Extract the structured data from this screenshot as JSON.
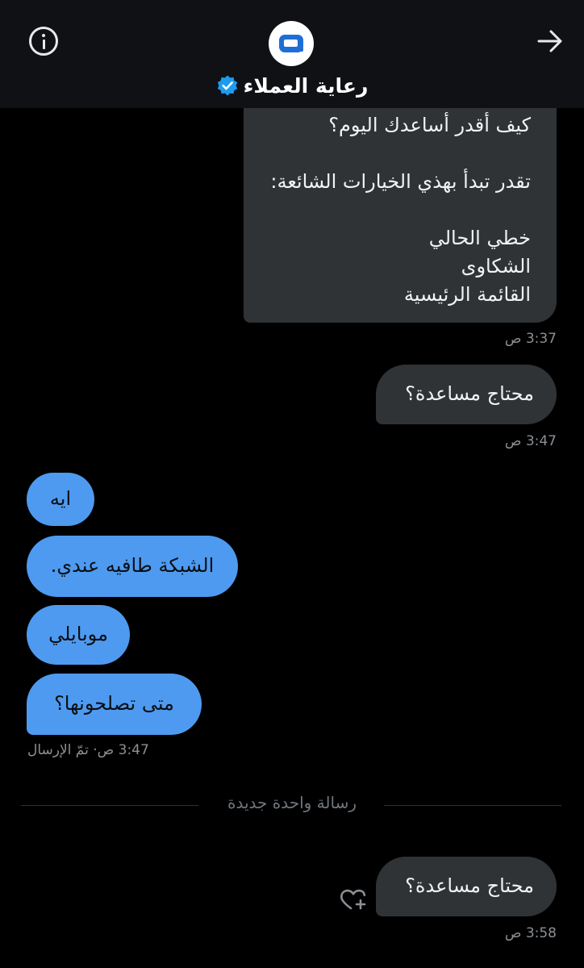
{
  "header": {
    "title": "رعاية العملاء",
    "avatar_icon": "mobily-logo-icon",
    "info_icon": "info-icon",
    "forward_icon": "arrow-right-icon",
    "verified_icon": "verified-badge-icon"
  },
  "colors": {
    "background": "#000000",
    "header": "#0f1114",
    "received_bubble": "#2f3336",
    "sent_bubble": "#4e9af0",
    "accent": "#1d9bf0",
    "timestamp": "#8b8f94"
  },
  "messages": {
    "menu": {
      "line1": "كيف أقدر أساعدك اليوم؟",
      "line2": "تقدر تبدأ بهذي الخيارات الشائعة:",
      "option1": "خطي الحالي",
      "option2": "الشكاوى",
      "option3": "القائمة الرئيسية",
      "time": "3:37 ص"
    },
    "help1": {
      "text": "محتاج مساعدة؟",
      "time": "3:47 ص"
    },
    "user": {
      "msg1": "ايه",
      "msg2": "الشبكة طافيه عندي.",
      "msg3": "موبايلي",
      "msg4": "متى تصلحونها؟",
      "status": "3:47 ص· تمّ الإرسال"
    },
    "divider": "رسالة واحدة جديدة",
    "help2": {
      "text": "محتاج مساعدة؟",
      "time": "3:58 ص",
      "react_icon": "heart-plus-icon"
    }
  }
}
